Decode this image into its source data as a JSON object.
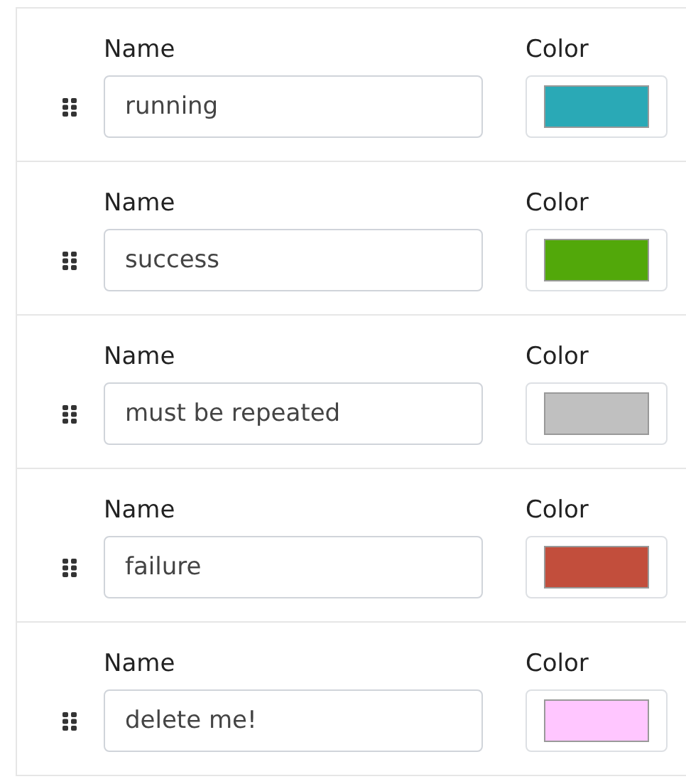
{
  "rows": [
    {
      "name_label": "Name",
      "name": "running",
      "color_label": "Color",
      "color": "#2aa9b6"
    },
    {
      "name_label": "Name",
      "name": "success",
      "color_label": "Color",
      "color": "#52a80a"
    },
    {
      "name_label": "Name",
      "name": "must be repeated",
      "color_label": "Color",
      "color": "#c0c0c0"
    },
    {
      "name_label": "Name",
      "name": "failure",
      "color_label": "Color",
      "color": "#c24e3c"
    },
    {
      "name_label": "Name",
      "name": "delete me!",
      "color_label": "Color",
      "color": "#ffc6ff"
    }
  ]
}
